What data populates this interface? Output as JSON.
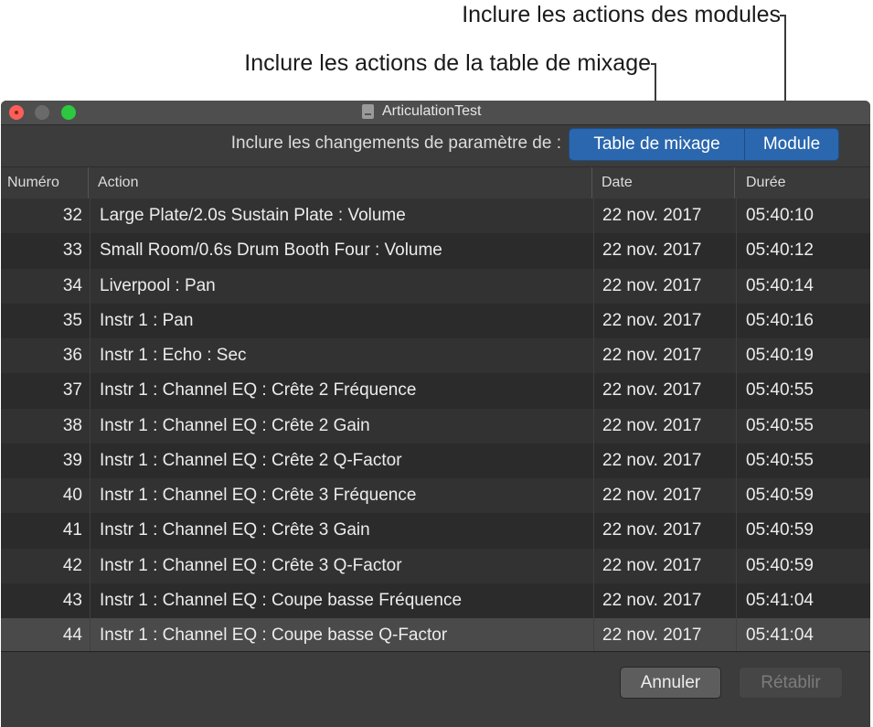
{
  "callouts": {
    "modules": "Inclure les actions des modules",
    "mixer": "Inclure les actions de la table de mixage"
  },
  "window": {
    "title": "ArticulationTest"
  },
  "filter": {
    "label": "Inclure les changements de paramètre de :",
    "options": [
      "Table de mixage",
      "Module"
    ]
  },
  "table": {
    "columns": [
      "Numéro",
      "Action",
      "Date",
      "Durée"
    ],
    "rows": [
      {
        "num": "32",
        "action": "Large Plate/2.0s Sustain Plate : Volume",
        "date": "22 nov. 2017",
        "time": "05:40:10"
      },
      {
        "num": "33",
        "action": "Small Room/0.6s Drum Booth Four : Volume",
        "date": "22 nov. 2017",
        "time": "05:40:12"
      },
      {
        "num": "34",
        "action": "Liverpool : Pan",
        "date": "22 nov. 2017",
        "time": "05:40:14"
      },
      {
        "num": "35",
        "action": "Instr 1 : Pan",
        "date": "22 nov. 2017",
        "time": "05:40:16"
      },
      {
        "num": "36",
        "action": "Instr 1 : Echo : Sec",
        "date": "22 nov. 2017",
        "time": "05:40:19"
      },
      {
        "num": "37",
        "action": "Instr 1 : Channel EQ : Crête 2 Fréquence",
        "date": "22 nov. 2017",
        "time": "05:40:55"
      },
      {
        "num": "38",
        "action": "Instr 1 : Channel EQ : Crête 2 Gain",
        "date": "22 nov. 2017",
        "time": "05:40:55"
      },
      {
        "num": "39",
        "action": "Instr 1 : Channel EQ : Crête 2 Q-Factor",
        "date": "22 nov. 2017",
        "time": "05:40:55"
      },
      {
        "num": "40",
        "action": "Instr 1 : Channel EQ : Crête 3 Fréquence",
        "date": "22 nov. 2017",
        "time": "05:40:59"
      },
      {
        "num": "41",
        "action": "Instr 1 : Channel EQ : Crête 3 Gain",
        "date": "22 nov. 2017",
        "time": "05:40:59"
      },
      {
        "num": "42",
        "action": "Instr 1 : Channel EQ : Crête 3 Q-Factor",
        "date": "22 nov. 2017",
        "time": "05:40:59"
      },
      {
        "num": "43",
        "action": "Instr 1 : Channel EQ : Coupe basse Fréquence",
        "date": "22 nov. 2017",
        "time": "05:41:04"
      },
      {
        "num": "44",
        "action": "Instr 1 : Channel EQ : Coupe basse Q-Factor",
        "date": "22 nov. 2017",
        "time": "05:41:04"
      }
    ],
    "selected_row": "44"
  },
  "footer": {
    "cancel": "Annuler",
    "redo": "Rétablir"
  },
  "colors": {
    "accent": "#2a67ae",
    "close": "#fc5f57",
    "zoom": "#2cc840"
  }
}
